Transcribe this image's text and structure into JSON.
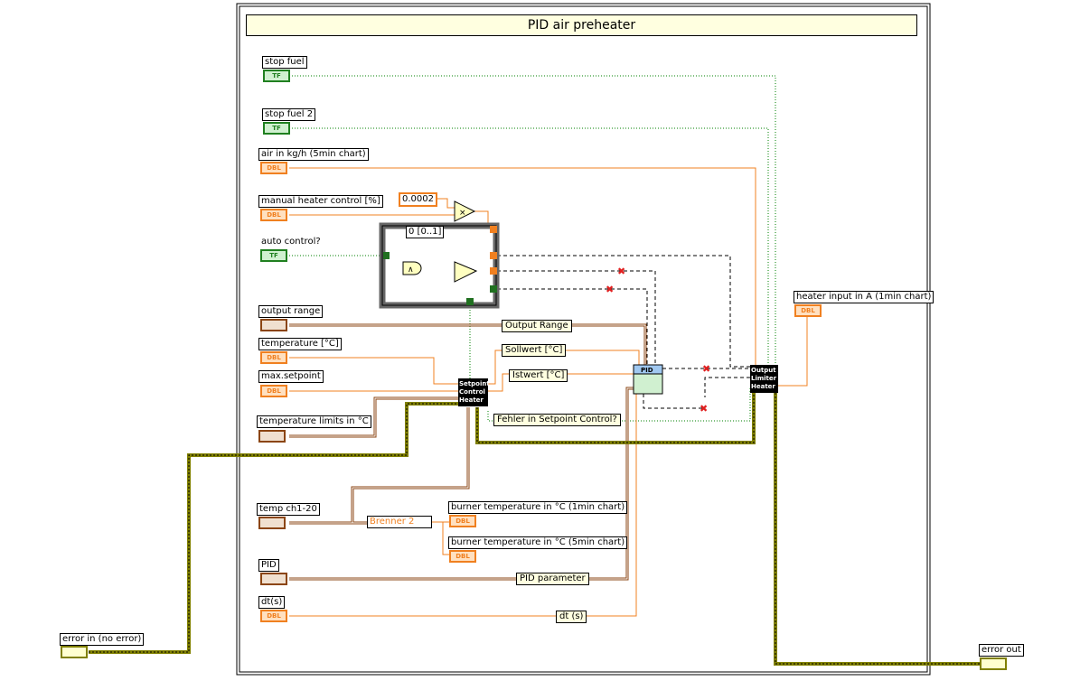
{
  "title": "PID air preheater",
  "controls": [
    {
      "label": "stop fuel",
      "type": "TF"
    },
    {
      "label": "stop fuel 2",
      "type": "TF"
    },
    {
      "label": "air in kg/h (5min chart)",
      "type": "DBL"
    },
    {
      "label": "manual heater control [%]",
      "type": "DBL"
    },
    {
      "label": "auto control?",
      "type": "TF"
    },
    {
      "label": "output range",
      "type": "CLUSTER"
    },
    {
      "label": "temperature [°C]",
      "type": "DBL"
    },
    {
      "label": "max.setpoint",
      "type": "DBL"
    },
    {
      "label": "temperature limits in °C",
      "type": "CLUSTER"
    },
    {
      "label": "temp ch1-20",
      "type": "CLUSTER"
    },
    {
      "label": "PID",
      "type": "CLUSTER"
    },
    {
      "label": "dt(s)",
      "type": "DBL"
    },
    {
      "label": "error in (no error)",
      "type": "ERR"
    }
  ],
  "indicators": [
    {
      "label": "heater input in A (1min chart)",
      "type": "DBL"
    },
    {
      "label": "burner temperature in °C (1min chart)",
      "type": "DBL"
    },
    {
      "label": "burner temperature in °C (5min chart)",
      "type": "DBL"
    },
    {
      "label": "error out",
      "type": "ERR"
    }
  ],
  "constant": "0.0002",
  "case_selector": "0 [0..1]",
  "subvis": {
    "setpoint": "Setpoint Control Heater",
    "pid": "PID",
    "limiter": "Output Limiter Heater"
  },
  "unbundle": "Brenner 2",
  "wire_labels": [
    "Output Range",
    "Sollwert [°C]",
    "Istwert [°C]",
    "Fehler in Setpoint Control?",
    "PID parameter",
    "dt (s)"
  ],
  "colors": {
    "dbl": "#f08020",
    "bool": "#208020",
    "cluster": "#8b4513",
    "error": "#808000"
  }
}
